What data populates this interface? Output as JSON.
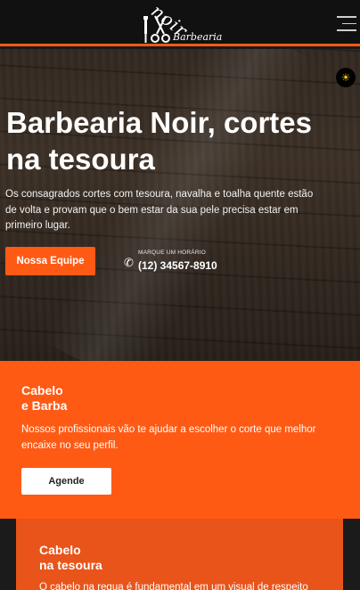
{
  "header": {
    "logo_script": "noir",
    "logo_word": "Barbearia",
    "menu_icon": "hamburger-menu-icon"
  },
  "hero": {
    "theme_icon": "sun-icon",
    "title_line1": "Barbearia Noir, cortes",
    "title_line2": "na tesoura",
    "description": "Os consagrados cortes com tesoura, navalha e toalha quente estão de volta e provam que o bem estar da sua pele precisa estar em primeiro lugar.",
    "team_button": "Nossa Equipe",
    "phone_caption": "MARQUE UM HORÁRIO",
    "phone_number": "(12) 34567-8910",
    "phone_icon": "phone-icon"
  },
  "service": {
    "title_line1": "Cabelo",
    "title_line2": "e Barba",
    "text": "Nossos profissionais vão te ajudar a escolher o corte que melhor encaixe no seu perfil.",
    "book_button": "Agende"
  },
  "card": {
    "title_line1": "Cabelo",
    "title_line2": "na tesoura",
    "text": "O cabelo na regua é fundamental em um visual de respeito"
  },
  "colors": {
    "accent": "#ff5a14",
    "header_bg": "#111111",
    "card_bg": "#e8541a"
  }
}
